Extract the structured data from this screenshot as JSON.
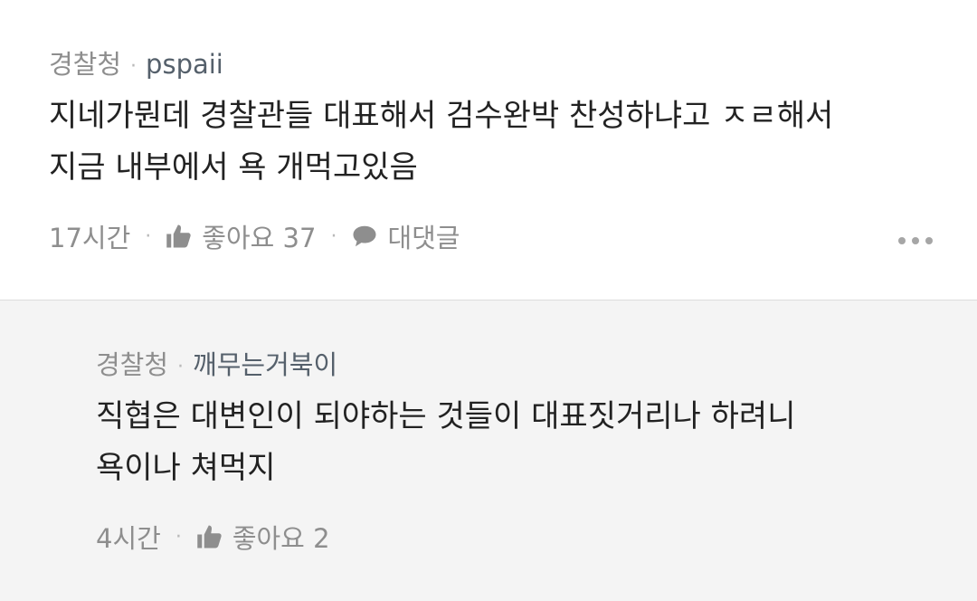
{
  "comments": [
    {
      "category": "경찰청",
      "username": "pspaii",
      "text_line1": "지네가뭔데 경찰관들 대표해서 검수완박 찬성하냐고 ㅈㄹ해서",
      "text_line2": "지금 내부에서 욕 개먹고있음",
      "time": "17시간",
      "likes_label": "좋아요 37",
      "reply_label": "대댓글"
    },
    {
      "category": "경찰청",
      "username": "깨무는거북이",
      "text_line1": "직협은 대변인이 되야하는 것들이 대표짓거리나 하려니",
      "text_line2": "욕이나 쳐먹지",
      "time": "4시간",
      "likes_label": "좋아요 2"
    }
  ],
  "separator": "·",
  "icons": {
    "like": "thumbs-up-icon",
    "reply": "speech-bubble-icon",
    "more": "more-dots-icon"
  },
  "colors": {
    "meta": "#8e8e8e",
    "username": "#55606b",
    "reply_bg": "#f4f4f4"
  }
}
